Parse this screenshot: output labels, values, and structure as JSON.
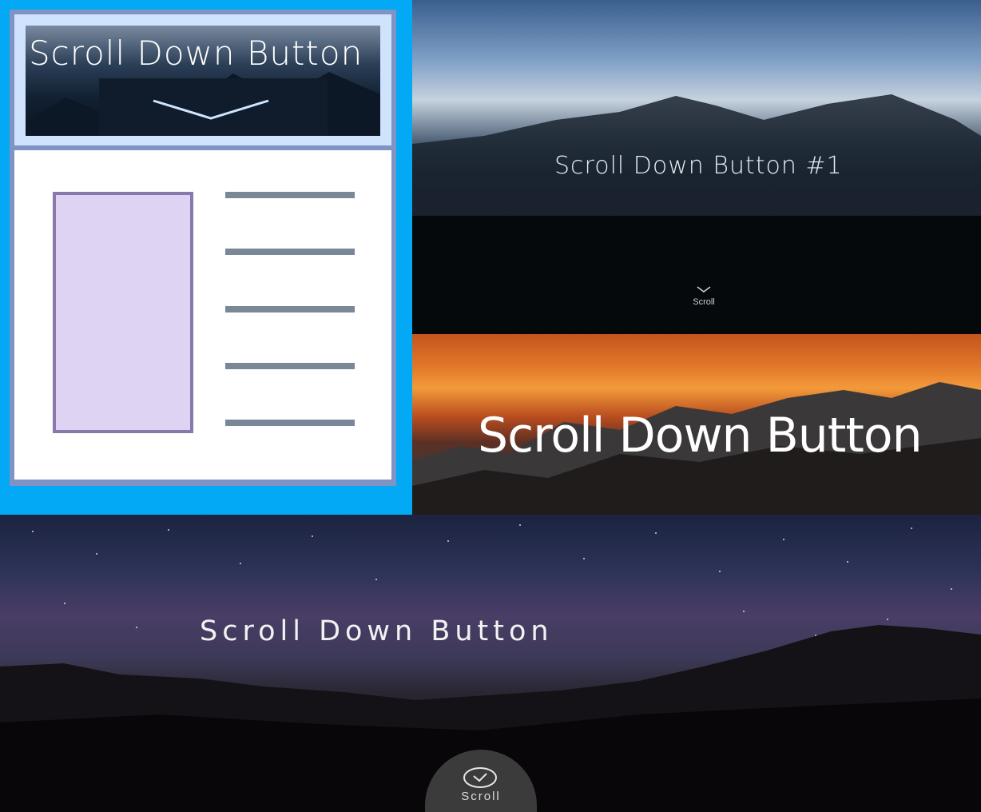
{
  "illustration": {
    "hero_title": "Scroll Down Button",
    "chevron_icon": "chevron-down-icon"
  },
  "lake_tile": {
    "title": "Scroll Down Button #1",
    "scroll_label": "Scroll",
    "chevron_icon": "chevron-down-icon"
  },
  "sunset_tile": {
    "title": "Scroll Down Button"
  },
  "night_tile": {
    "title": "Scroll Down Button",
    "button_label": "Scroll",
    "button_icon": "chevron-circle-icon"
  },
  "colors": {
    "accent_blue": "#03a9f4",
    "illustration_image": "#ded3f2",
    "illustration_lines": "#7a8796"
  }
}
